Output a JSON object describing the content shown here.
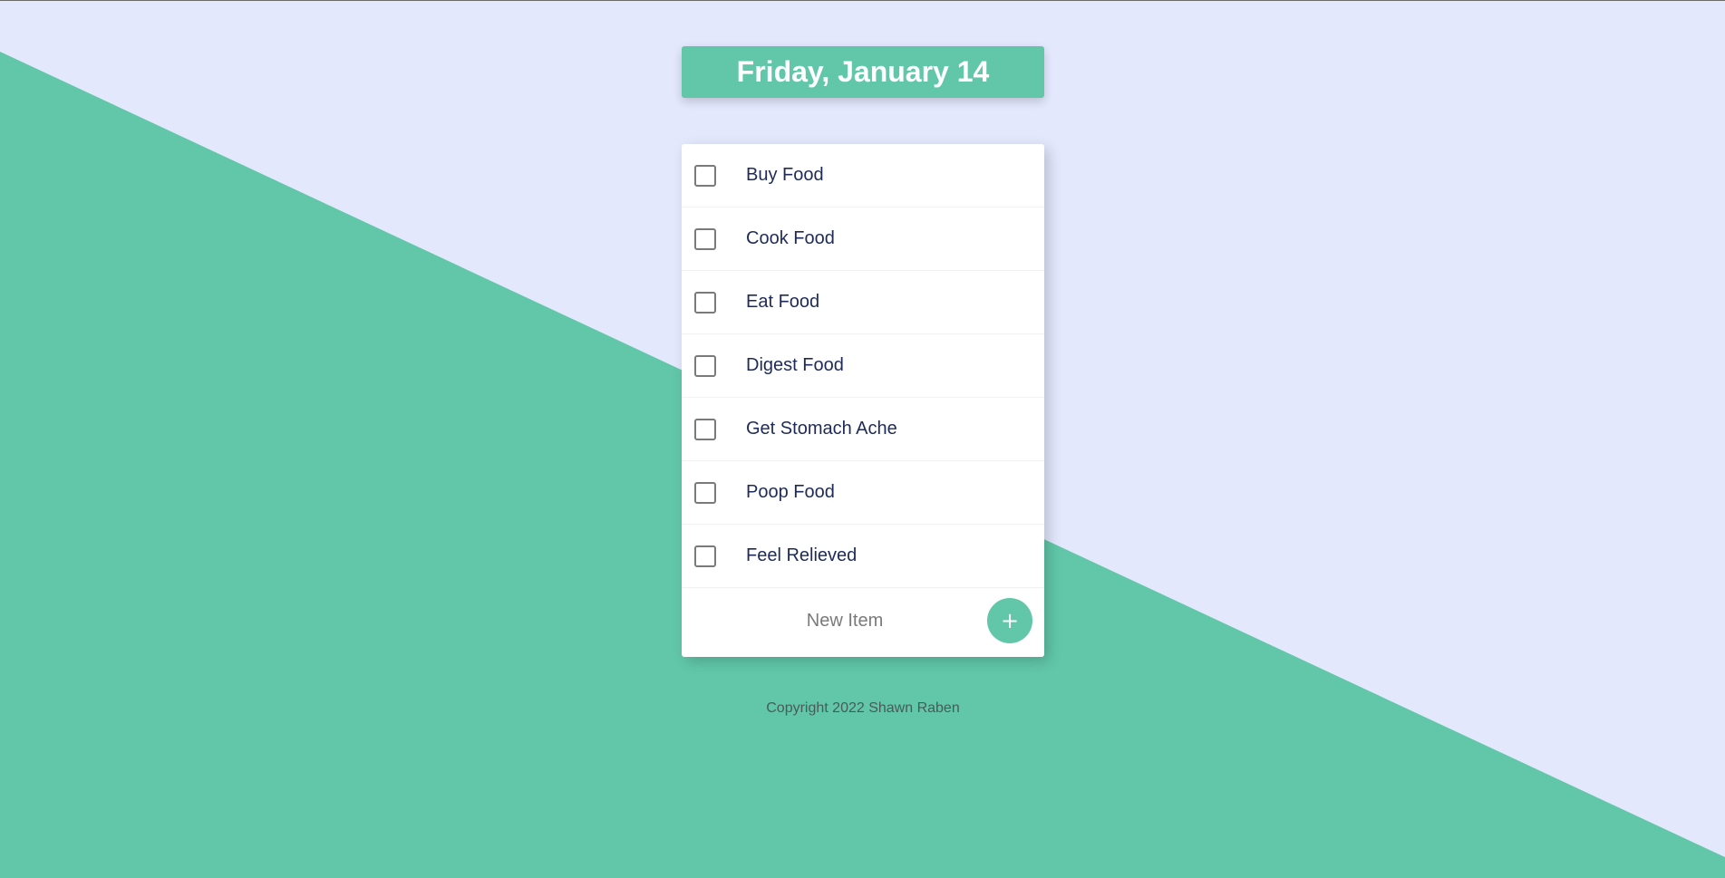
{
  "header": {
    "date": "Friday, January 14"
  },
  "todo": {
    "items": [
      {
        "label": "Buy Food",
        "checked": false
      },
      {
        "label": "Cook Food",
        "checked": false
      },
      {
        "label": "Eat Food",
        "checked": false
      },
      {
        "label": "Digest Food",
        "checked": false
      },
      {
        "label": "Get Stomach Ache",
        "checked": false
      },
      {
        "label": "Poop Food",
        "checked": false
      },
      {
        "label": "Feel Relieved",
        "checked": false
      }
    ],
    "new_item_placeholder": "New Item",
    "new_item_value": "",
    "add_button_label": "+",
    "add_button_icon": "plus-icon"
  },
  "footer": {
    "copyright": "Copyright 2022 Shawn Raben"
  },
  "colors": {
    "accent": "#61C7A8",
    "background": "#E4E8FD",
    "text": "#1E2A5A"
  }
}
